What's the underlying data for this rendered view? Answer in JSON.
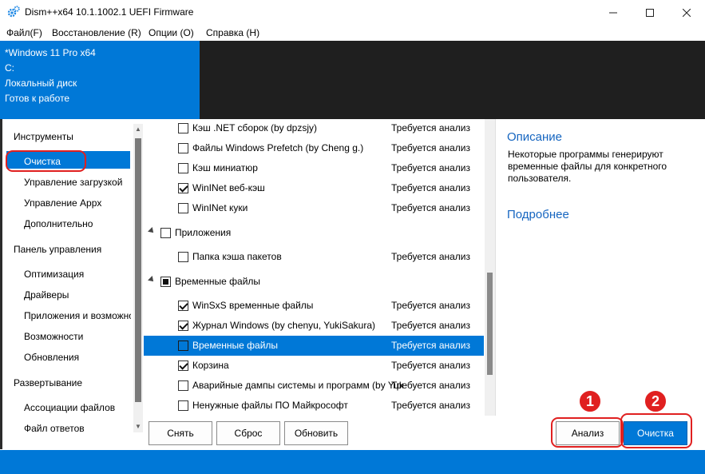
{
  "window": {
    "title": "Dism++x64 10.1.1002.1 UEFI Firmware"
  },
  "menu": [
    "Файл(F)",
    "Восстановление (R)",
    "Опции (O)",
    "Справка (H)"
  ],
  "info": [
    "*Windows 11 Pro x64",
    "C:",
    "Локальный диск",
    "Готов к работе"
  ],
  "sidebar": {
    "groups": [
      "Инструменты",
      "Панель управления",
      "Развертывание"
    ],
    "items": [
      "Очистка",
      "Управление загрузкой",
      "Управление Appx",
      "Дополнительно",
      "Оптимизация",
      "Драйверы",
      "Приложения и возможности",
      "Возможности",
      "Обновления",
      "Ассоциации файлов",
      "Файл ответов"
    ]
  },
  "tree": [
    {
      "label": "Кэш .NET сборок (by dpzsjy)",
      "status": "Требуется анализ",
      "state": "unchecked"
    },
    {
      "label": "Файлы Windows Prefetch (by Cheng g.)",
      "status": "Требуется анализ",
      "state": "unchecked"
    },
    {
      "label": "Кэш миниатюр",
      "status": "Требуется анализ",
      "state": "unchecked"
    },
    {
      "label": "WinINet веб-кэш",
      "status": "Требуется анализ",
      "state": "checked"
    },
    {
      "label": "WinINet куки",
      "status": "Требуется анализ",
      "state": "unchecked"
    },
    {
      "label": "Приложения",
      "status": "",
      "state": "unchecked",
      "group": true
    },
    {
      "label": "Папка кэша пакетов",
      "status": "Требуется анализ",
      "state": "unchecked"
    },
    {
      "label": "Временные файлы",
      "status": "",
      "state": "partial",
      "group": true
    },
    {
      "label": "WinSxS временные файлы",
      "status": "Требуется анализ",
      "state": "checked"
    },
    {
      "label": "Журнал Windows (by chenyu, YukiSakura)",
      "status": "Требуется анализ",
      "state": "checked"
    },
    {
      "label": "Временные файлы",
      "status": "Требуется анализ",
      "state": "unchecked",
      "selected": true
    },
    {
      "label": "Корзина",
      "status": "Требуется анализ",
      "state": "checked"
    },
    {
      "label": "Аварийные дампы системы и программ (by YukiSakura)",
      "status": "Требуется анализ",
      "state": "unchecked"
    },
    {
      "label": "Ненужные файлы ПО Майкрософт",
      "status": "Требуется анализ",
      "state": "unchecked"
    }
  ],
  "description": {
    "title": "Описание",
    "text": "Некоторые программы генерируют временные файлы для конкретного пользователя.",
    "more": "Подробнее"
  },
  "buttons": {
    "remove": "Снять",
    "reset": "Сброс",
    "refresh": "Обновить",
    "analyze": "Анализ",
    "clean": "Очистка"
  },
  "markers": [
    "1",
    "2"
  ],
  "colors": {
    "accent": "#0078d7",
    "marker": "#e02020",
    "link": "#1565c0"
  }
}
